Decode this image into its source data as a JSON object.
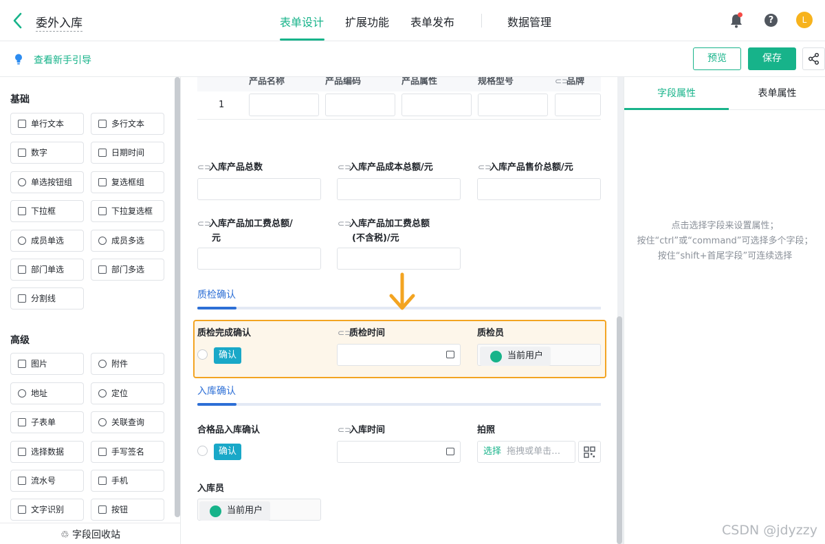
{
  "header": {
    "back_icon": "chevron-left-icon",
    "title": "委外入库",
    "tabs": [
      {
        "label": "表单设计",
        "active": true
      },
      {
        "label": "扩展功能"
      },
      {
        "label": "表单发布"
      },
      {
        "label": "数据管理"
      }
    ],
    "avatar_letter": "L",
    "accent_color": "#17b38a"
  },
  "subbar": {
    "guide_label": "查看新手引导",
    "preview_label": "预览",
    "save_label": "保存"
  },
  "sidebar": {
    "basic_title": "基础",
    "basic_items": [
      "单行文本",
      "多行文本",
      "数字",
      "日期时间",
      "单选按钮组",
      "复选框组",
      "下拉框",
      "下拉复选框",
      "成员单选",
      "成员多选",
      "部门单选",
      "部门多选",
      "分割线"
    ],
    "advanced_title": "高级",
    "advanced_items": [
      "图片",
      "附件",
      "地址",
      "定位",
      "子表单",
      "关联查询",
      "选择数据",
      "手写签名",
      "流水号",
      "手机",
      "文字识别",
      "按钮"
    ],
    "recycle_label": "字段回收站"
  },
  "canvas": {
    "table": {
      "headers": [
        "产品名称",
        "产品编码",
        "产品属性",
        "规格型号",
        "品牌"
      ],
      "row_index": "1"
    },
    "fields_row1": [
      "入库产品总数",
      "入库产品成本总额/元",
      "入库产品售价总额/元"
    ],
    "field_processing_total_l1": "入库产品加工费总额/",
    "field_processing_total_l2": "元",
    "field_processing_pretax_l1": "入库产品加工费总额",
    "field_processing_pretax_l2": "(不含税)/元",
    "section_qc": "质检确认",
    "qc_done_label": "质检完成确认",
    "qc_confirm_btn": "确认",
    "qc_time_label": "质检时间",
    "qc_inspector_label": "质检员",
    "qc_inspector_value": "当前用户",
    "section_stockin": "入库确认",
    "ok_stockin_label": "合格品入库确认",
    "ok_confirm_btn": "确认",
    "stockin_time_label": "入库时间",
    "photo_label": "拍照",
    "photo_select": "选择",
    "photo_placeholder": "拖拽或单击…",
    "stockin_clerk_label": "入库员",
    "stockin_clerk_value": "当前用户"
  },
  "right_panel": {
    "tab_field": "字段属性",
    "tab_form": "表单属性",
    "hint_line1": "点击选择字段来设置属性；",
    "hint_line2": "按住“ctrl”或“command”可选择多个字段；",
    "hint_line3": "按住“shift+首尾字段”可连续选择"
  },
  "watermark": "CSDN @jdyzzy"
}
